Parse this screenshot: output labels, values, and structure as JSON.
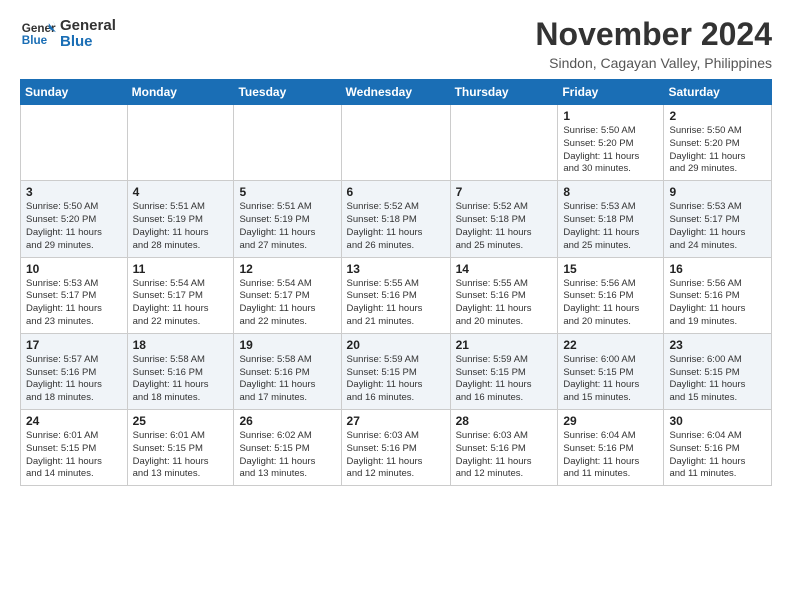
{
  "header": {
    "logo_line1": "General",
    "logo_line2": "Blue",
    "month_title": "November 2024",
    "location": "Sindon, Cagayan Valley, Philippines"
  },
  "weekdays": [
    "Sunday",
    "Monday",
    "Tuesday",
    "Wednesday",
    "Thursday",
    "Friday",
    "Saturday"
  ],
  "weeks": [
    [
      {
        "day": "",
        "info": ""
      },
      {
        "day": "",
        "info": ""
      },
      {
        "day": "",
        "info": ""
      },
      {
        "day": "",
        "info": ""
      },
      {
        "day": "",
        "info": ""
      },
      {
        "day": "1",
        "info": "Sunrise: 5:50 AM\nSunset: 5:20 PM\nDaylight: 11 hours\nand 30 minutes."
      },
      {
        "day": "2",
        "info": "Sunrise: 5:50 AM\nSunset: 5:20 PM\nDaylight: 11 hours\nand 29 minutes."
      }
    ],
    [
      {
        "day": "3",
        "info": "Sunrise: 5:50 AM\nSunset: 5:20 PM\nDaylight: 11 hours\nand 29 minutes."
      },
      {
        "day": "4",
        "info": "Sunrise: 5:51 AM\nSunset: 5:19 PM\nDaylight: 11 hours\nand 28 minutes."
      },
      {
        "day": "5",
        "info": "Sunrise: 5:51 AM\nSunset: 5:19 PM\nDaylight: 11 hours\nand 27 minutes."
      },
      {
        "day": "6",
        "info": "Sunrise: 5:52 AM\nSunset: 5:18 PM\nDaylight: 11 hours\nand 26 minutes."
      },
      {
        "day": "7",
        "info": "Sunrise: 5:52 AM\nSunset: 5:18 PM\nDaylight: 11 hours\nand 25 minutes."
      },
      {
        "day": "8",
        "info": "Sunrise: 5:53 AM\nSunset: 5:18 PM\nDaylight: 11 hours\nand 25 minutes."
      },
      {
        "day": "9",
        "info": "Sunrise: 5:53 AM\nSunset: 5:17 PM\nDaylight: 11 hours\nand 24 minutes."
      }
    ],
    [
      {
        "day": "10",
        "info": "Sunrise: 5:53 AM\nSunset: 5:17 PM\nDaylight: 11 hours\nand 23 minutes."
      },
      {
        "day": "11",
        "info": "Sunrise: 5:54 AM\nSunset: 5:17 PM\nDaylight: 11 hours\nand 22 minutes."
      },
      {
        "day": "12",
        "info": "Sunrise: 5:54 AM\nSunset: 5:17 PM\nDaylight: 11 hours\nand 22 minutes."
      },
      {
        "day": "13",
        "info": "Sunrise: 5:55 AM\nSunset: 5:16 PM\nDaylight: 11 hours\nand 21 minutes."
      },
      {
        "day": "14",
        "info": "Sunrise: 5:55 AM\nSunset: 5:16 PM\nDaylight: 11 hours\nand 20 minutes."
      },
      {
        "day": "15",
        "info": "Sunrise: 5:56 AM\nSunset: 5:16 PM\nDaylight: 11 hours\nand 20 minutes."
      },
      {
        "day": "16",
        "info": "Sunrise: 5:56 AM\nSunset: 5:16 PM\nDaylight: 11 hours\nand 19 minutes."
      }
    ],
    [
      {
        "day": "17",
        "info": "Sunrise: 5:57 AM\nSunset: 5:16 PM\nDaylight: 11 hours\nand 18 minutes."
      },
      {
        "day": "18",
        "info": "Sunrise: 5:58 AM\nSunset: 5:16 PM\nDaylight: 11 hours\nand 18 minutes."
      },
      {
        "day": "19",
        "info": "Sunrise: 5:58 AM\nSunset: 5:16 PM\nDaylight: 11 hours\nand 17 minutes."
      },
      {
        "day": "20",
        "info": "Sunrise: 5:59 AM\nSunset: 5:15 PM\nDaylight: 11 hours\nand 16 minutes."
      },
      {
        "day": "21",
        "info": "Sunrise: 5:59 AM\nSunset: 5:15 PM\nDaylight: 11 hours\nand 16 minutes."
      },
      {
        "day": "22",
        "info": "Sunrise: 6:00 AM\nSunset: 5:15 PM\nDaylight: 11 hours\nand 15 minutes."
      },
      {
        "day": "23",
        "info": "Sunrise: 6:00 AM\nSunset: 5:15 PM\nDaylight: 11 hours\nand 15 minutes."
      }
    ],
    [
      {
        "day": "24",
        "info": "Sunrise: 6:01 AM\nSunset: 5:15 PM\nDaylight: 11 hours\nand 14 minutes."
      },
      {
        "day": "25",
        "info": "Sunrise: 6:01 AM\nSunset: 5:15 PM\nDaylight: 11 hours\nand 13 minutes."
      },
      {
        "day": "26",
        "info": "Sunrise: 6:02 AM\nSunset: 5:15 PM\nDaylight: 11 hours\nand 13 minutes."
      },
      {
        "day": "27",
        "info": "Sunrise: 6:03 AM\nSunset: 5:16 PM\nDaylight: 11 hours\nand 12 minutes."
      },
      {
        "day": "28",
        "info": "Sunrise: 6:03 AM\nSunset: 5:16 PM\nDaylight: 11 hours\nand 12 minutes."
      },
      {
        "day": "29",
        "info": "Sunrise: 6:04 AM\nSunset: 5:16 PM\nDaylight: 11 hours\nand 11 minutes."
      },
      {
        "day": "30",
        "info": "Sunrise: 6:04 AM\nSunset: 5:16 PM\nDaylight: 11 hours\nand 11 minutes."
      }
    ]
  ]
}
